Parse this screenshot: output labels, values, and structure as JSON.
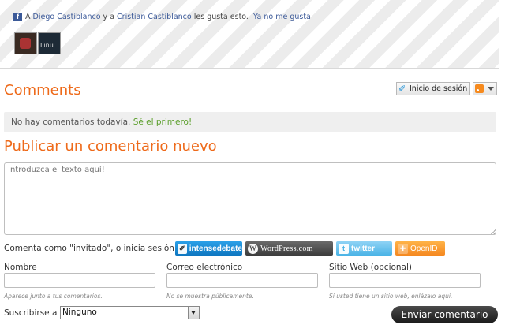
{
  "likes": {
    "prefix": "A",
    "user1": "Diego Castiblanco",
    "connector": "y a",
    "user2": "Cristian Castiblanco",
    "suffix": "les gusta esto.",
    "unlike": "Ya no me gusta",
    "avatar2_text": "Linu"
  },
  "comments": {
    "title": "Comments",
    "login_label": "Inicio de sesión",
    "empty_msg": "No hay comentarios todavía.",
    "be_first": "Sé el primero!"
  },
  "post": {
    "title": "Publicar un comentario nuevo",
    "textarea_placeholder": "Introduzca el texto aquí!",
    "comment_as": "Comenta como \"invitado\", o inicia sesión:",
    "services": {
      "intensedebate": "intensedebate",
      "wordpress": "WordPress.com",
      "twitter": "twitter",
      "openid": "OpenID"
    },
    "fields": {
      "name_label": "Nombre",
      "name_hint": "Aparece junto a tus comentarios.",
      "email_label": "Correo electrónico",
      "email_hint": "No se muestra públicamente.",
      "web_label": "Sitio Web (opcional)",
      "web_hint": "Si usted tiene un sitio web, enlázalo aquí."
    },
    "subscribe_label": "Suscribirse a",
    "subscribe_value": "Ninguno",
    "submit": "Enviar comentario"
  },
  "colors": {
    "heading": "#ee6a1a",
    "facebook": "#3b5998",
    "be_first": "#5a9e2a"
  }
}
